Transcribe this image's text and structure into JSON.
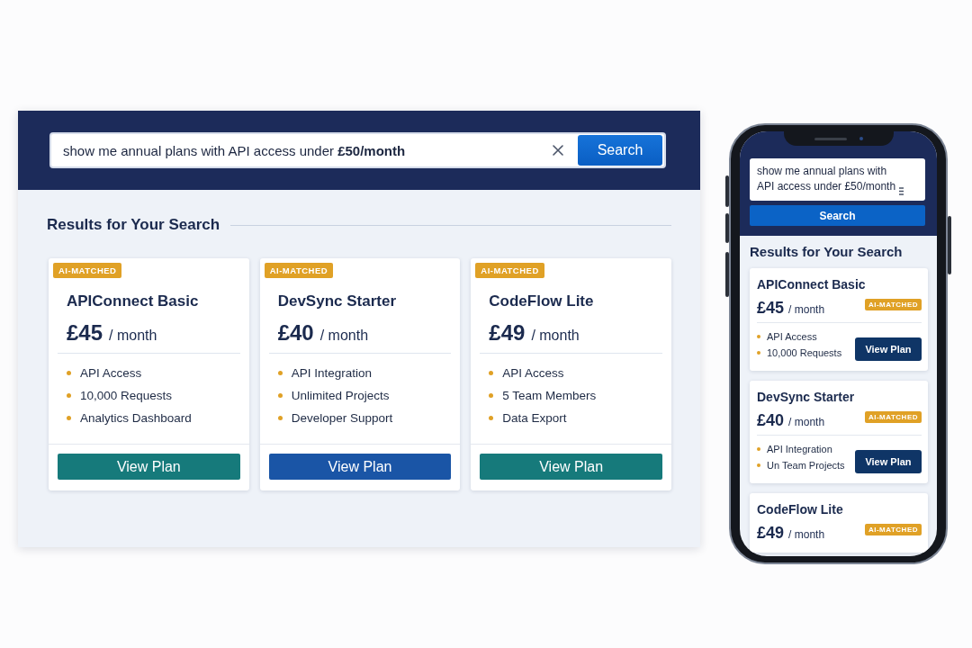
{
  "desktop": {
    "search": {
      "value": "show me annual plans with API access under **£50/month**",
      "button": "Search"
    },
    "results_title": "Results for Your Search",
    "plans": [
      {
        "badge": "AI-MATCHED",
        "name": "APIConnect Basic",
        "price": "£45",
        "period": "/ month",
        "features": [
          "API Access",
          "10,000 Requests",
          "Analytics Dashboard"
        ],
        "button": {
          "label": "View Plan",
          "color": "#167a7b"
        }
      },
      {
        "badge": "AI-MATCHED",
        "name": "DevSync Starter",
        "price": "£40",
        "period": "/ month",
        "features": [
          "API Integration",
          "Unlimited Projects",
          "Developer Support"
        ],
        "button": {
          "label": "View Plan",
          "color": "#1a55a6"
        }
      },
      {
        "badge": "AI-MATCHED",
        "name": "CodeFlow Lite",
        "price": "£49",
        "period": "/ month",
        "features": [
          "API Access",
          "5 Team Members",
          "Data Export"
        ],
        "button": {
          "label": "View Plan",
          "color": "#167a7b"
        }
      }
    ]
  },
  "phone": {
    "search": {
      "value": "show me annual plans with API access under £50/month",
      "button": "Search"
    },
    "results_title": "Results for Your Search",
    "plans": [
      {
        "name": "APIConnect Basic",
        "price": "£45",
        "period": "/ month",
        "badge": "AI-MATCHED",
        "features": [
          "API Access",
          "10,000 Requests"
        ],
        "button": "View Plan"
      },
      {
        "name": "DevSync Starter",
        "price": "£40",
        "period": "/ month",
        "badge": "AI-MATCHED",
        "features": [
          "API Integration",
          "Un Team Projects"
        ],
        "button": "View Plan"
      },
      {
        "name": "CodeFlow Lite",
        "price": "£49",
        "period": "/ month",
        "badge": "AI-MATCHED"
      }
    ]
  }
}
